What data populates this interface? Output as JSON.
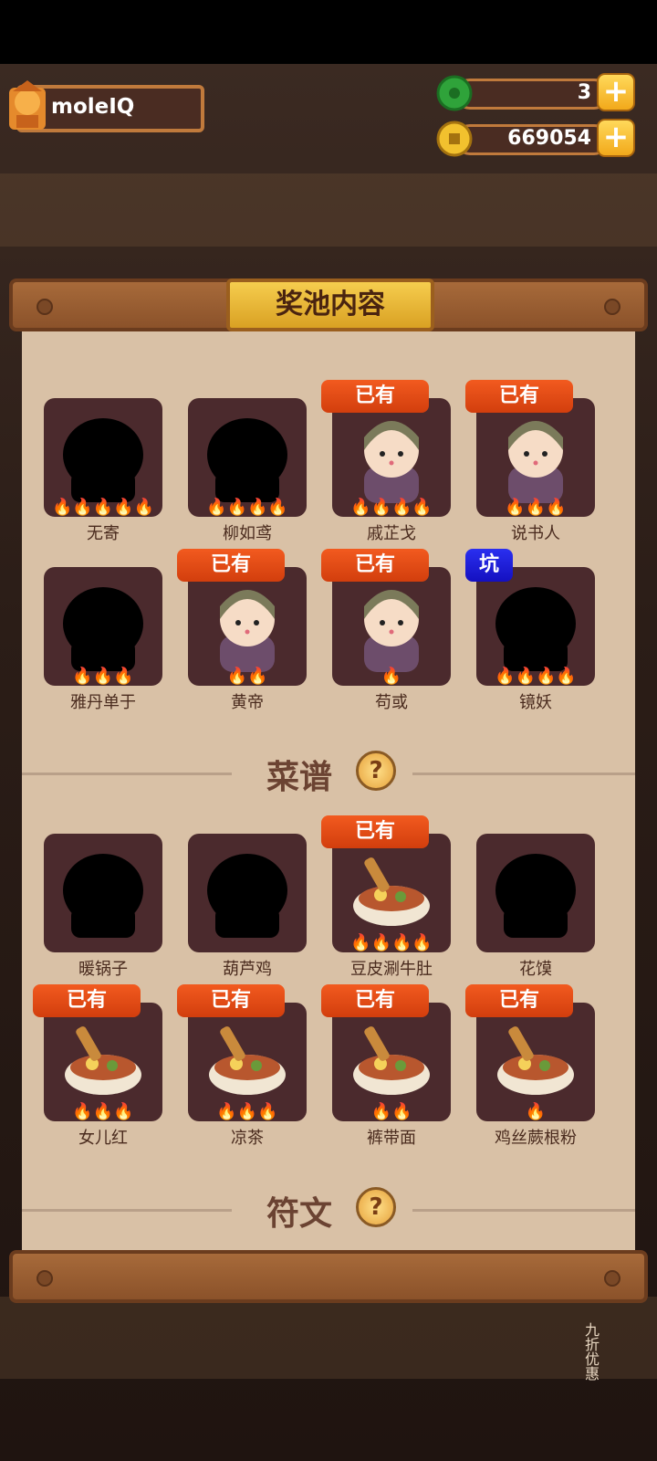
{
  "player": {
    "name": "moleIQ"
  },
  "resources": {
    "jade": "3",
    "coins": "669054",
    "plus_label": "+"
  },
  "panel": {
    "title": "奖池内容"
  },
  "characters": [
    {
      "name": "无寄",
      "owned": false,
      "badge": "",
      "flames": 5
    },
    {
      "name": "柳如鸢",
      "owned": false,
      "badge": "",
      "flames": 4
    },
    {
      "name": "戚芷戈",
      "owned": true,
      "badge": "已有",
      "flames": 4
    },
    {
      "name": "说书人",
      "owned": true,
      "badge": "已有",
      "flames": 3
    },
    {
      "name": "雅丹单于",
      "owned": false,
      "badge": "",
      "flames": 3
    },
    {
      "name": "黄帝",
      "owned": true,
      "badge": "已有",
      "flames": 2
    },
    {
      "name": "苟或",
      "owned": true,
      "badge": "已有",
      "flames": 1
    },
    {
      "name": "镜妖",
      "owned": false,
      "badge": "坑",
      "flames": 4
    }
  ],
  "recipes_section": {
    "title": "菜谱",
    "help": "?"
  },
  "recipes": [
    {
      "name": "暖锅子",
      "owned": false,
      "badge": "",
      "flames": 0
    },
    {
      "name": "葫芦鸡",
      "owned": false,
      "badge": "",
      "flames": 0
    },
    {
      "name": "豆皮涮牛肚",
      "owned": true,
      "badge": "已有",
      "flames": 4
    },
    {
      "name": "花馍",
      "owned": false,
      "badge": "",
      "flames": 0
    },
    {
      "name": "女儿红",
      "owned": true,
      "badge": "已有",
      "flames": 3
    },
    {
      "name": "凉茶",
      "owned": true,
      "badge": "已有",
      "flames": 3
    },
    {
      "name": "裤带面",
      "owned": true,
      "badge": "已有",
      "flames": 2
    },
    {
      "name": "鸡丝蕨根粉",
      "owned": true,
      "badge": "已有",
      "flames": 1
    }
  ],
  "next_section": {
    "title": "符文",
    "help": "?"
  },
  "side_promo": "九折优惠",
  "colors": {
    "badge_owned": "#e0481a",
    "badge_pit": "#1d1fd8",
    "card_bg": "#4b2a2d",
    "panel_bg": "#d9c1a6"
  }
}
